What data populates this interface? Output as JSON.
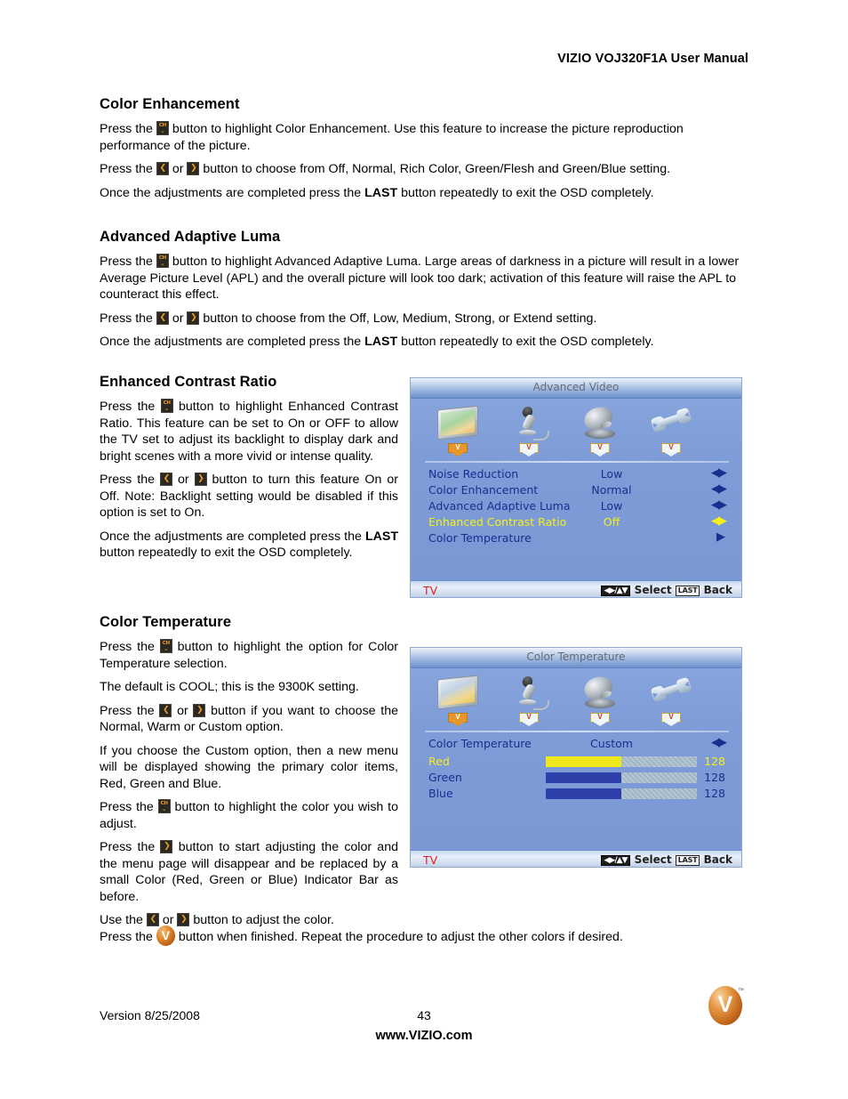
{
  "document": {
    "running_header": "VIZIO VOJ320F1A User Manual",
    "version": "Version 8/25/2008",
    "page_number": "43",
    "website": "www.VIZIO.com"
  },
  "sections": {
    "color_enhancement": {
      "title": "Color Enhancement",
      "p1_a": "Press the",
      "p1_b": "button to highlight Color Enhancement.  Use this feature to increase the picture reproduction performance of the picture.",
      "p2_a": "Press the",
      "p2_or": "or",
      "p2_b": "button to choose from Off, Normal, Rich Color, Green/Flesh and Green/Blue setting.",
      "p3_a": "Once the adjustments are completed press the",
      "p3_bold": "LAST",
      "p3_b": "button repeatedly to exit the OSD completely."
    },
    "advanced_adaptive_luma": {
      "title": "Advanced Adaptive Luma",
      "p1_a": "Press the",
      "p1_b": "button to highlight Advanced Adaptive Luma. Large areas of darkness in a picture will result in a lower Average Picture Level (APL) and the overall picture will look too dark; activation of this feature will raise the APL to counteract this effect.",
      "p2_a": "Press the",
      "p2_or": "or",
      "p2_b": "button to choose from the Off, Low, Medium, Strong, or Extend setting.",
      "p3_a": "Once the adjustments are completed press the",
      "p3_bold": "LAST",
      "p3_b": "button repeatedly to exit the OSD completely."
    },
    "enhanced_contrast_ratio": {
      "title": "Enhanced Contrast Ratio",
      "p1_a": "Press the",
      "p1_b": "button to highlight Enhanced Contrast Ratio.  This feature can be set to On or OFF to allow the TV set to adjust its backlight to display dark and bright scenes with a more vivid or intense quality.",
      "p2_a": "Press the",
      "p2_or": "or",
      "p2_b": "button to turn this feature On or Off. Note: Backlight setting would be disabled if this option is set to On.",
      "p3_a": "Once the adjustments are completed press the",
      "p3_bold": "LAST",
      "p3_b": "button repeatedly to exit the OSD completely."
    },
    "color_temperature": {
      "title": "Color Temperature",
      "p1_a": "Press the",
      "p1_b": "button to highlight the option for Color Temperature selection.",
      "p2": "The default is COOL; this is the 9300K setting.",
      "p3_a": "Press the",
      "p3_or": "or",
      "p3_b": "button if you want to choose the Normal, Warm or Custom option.",
      "p4": "If you choose the Custom option, then a new menu will be displayed showing the primary color items, Red, Green and Blue.",
      "p5_a": "Press the",
      "p5_b": "button to highlight the color you wish to adjust.",
      "p6_a": "Press the",
      "p6_b": "button to start adjusting the color and the menu page will disappear and be replaced by a small Color (Red, Green or Blue) Indicator Bar as before.",
      "p7_a": "Use the",
      "p7_or": "or",
      "p7_b": "button to adjust the color.",
      "p8_a": "Press the",
      "p8_b": "button when finished.  Repeat the procedure to adjust the other colors if desired."
    }
  },
  "osd_advanced_video": {
    "title": "Advanced Video",
    "icons": [
      {
        "name": "picture-icon",
        "badge": "V",
        "selected": true
      },
      {
        "name": "audio-microphone-icon",
        "badge": "V",
        "selected": false
      },
      {
        "name": "tuner-satellite-dish-icon",
        "badge": "V",
        "selected": false
      },
      {
        "name": "setup-wrench-icon",
        "badge": "V",
        "selected": false
      }
    ],
    "rows": [
      {
        "label": "Noise Reduction",
        "value": "Low",
        "arrow": "left-right",
        "highlighted": false
      },
      {
        "label": "Color Enhancement",
        "value": "Normal",
        "arrow": "left-right",
        "highlighted": false
      },
      {
        "label": "Advanced Adaptive Luma",
        "value": "Low",
        "arrow": "left-right",
        "highlighted": false
      },
      {
        "label": "Enhanced Contrast Ratio",
        "value": "Off",
        "arrow": "left-right",
        "highlighted": true
      },
      {
        "label": "Color Temperature",
        "value": "",
        "arrow": "right",
        "highlighted": false
      }
    ],
    "footer": {
      "source": "TV",
      "select_label": "Select",
      "back_key": "LAST",
      "back_label": "Back"
    }
  },
  "osd_color_temperature": {
    "title": "Color Temperature",
    "icons": [
      {
        "name": "picture-icon",
        "badge": "V",
        "selected": true
      },
      {
        "name": "audio-microphone-icon",
        "badge": "V",
        "selected": false
      },
      {
        "name": "tuner-satellite-dish-icon",
        "badge": "V",
        "selected": false
      },
      {
        "name": "setup-wrench-icon",
        "badge": "V",
        "selected": false
      }
    ],
    "mode_row": {
      "label": "Color Temperature",
      "value": "Custom",
      "arrow": "left-right"
    },
    "sliders": [
      {
        "label": "Red",
        "value": "128",
        "percent": 50,
        "highlighted": true
      },
      {
        "label": "Green",
        "value": "128",
        "percent": 50,
        "highlighted": false
      },
      {
        "label": "Blue",
        "value": "128",
        "percent": 50,
        "highlighted": false
      }
    ],
    "footer": {
      "source": "TV",
      "select_label": "Select",
      "back_key": "LAST",
      "back_label": "Back"
    }
  },
  "colors": {
    "osd_background": "#7b9ad8",
    "osd_text": "#1a2e8f",
    "osd_highlight": "#f6f018",
    "osd_source_red": "#e02020",
    "slider_fill": "#2d3fa8",
    "slider_fill_red": "#efe81c",
    "vizio_orange": "#d4801f"
  }
}
